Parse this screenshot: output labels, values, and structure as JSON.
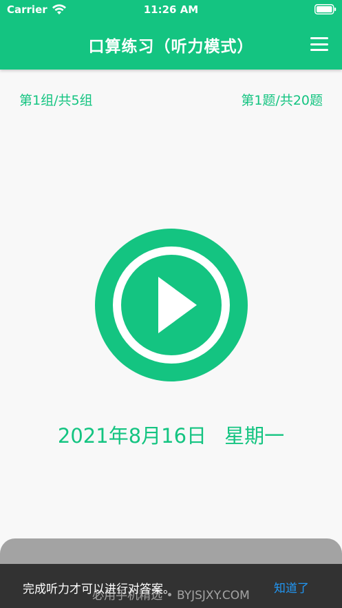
{
  "status_bar": {
    "carrier": "Carrier",
    "time": "11:26 AM"
  },
  "nav": {
    "title": "口算练习（听力模式）",
    "menu_icon": "hamburger-menu-icon"
  },
  "progress": {
    "group": "第1组/共5组",
    "question": "第1题/共20题"
  },
  "player": {
    "icon": "play-icon"
  },
  "date": {
    "date_text": "2021年8月16日",
    "weekday": "星期一"
  },
  "toast": {
    "message": "完成听力才可以进行对答案。",
    "action": "知道了"
  },
  "watermark": "必用手机精选 • BYJSJXY.COM",
  "colors": {
    "primary": "#14c481",
    "background": "#f8f8f8",
    "toast_bg": "#323232",
    "toast_action": "#2196f3",
    "sheet": "#a3a3a3"
  }
}
